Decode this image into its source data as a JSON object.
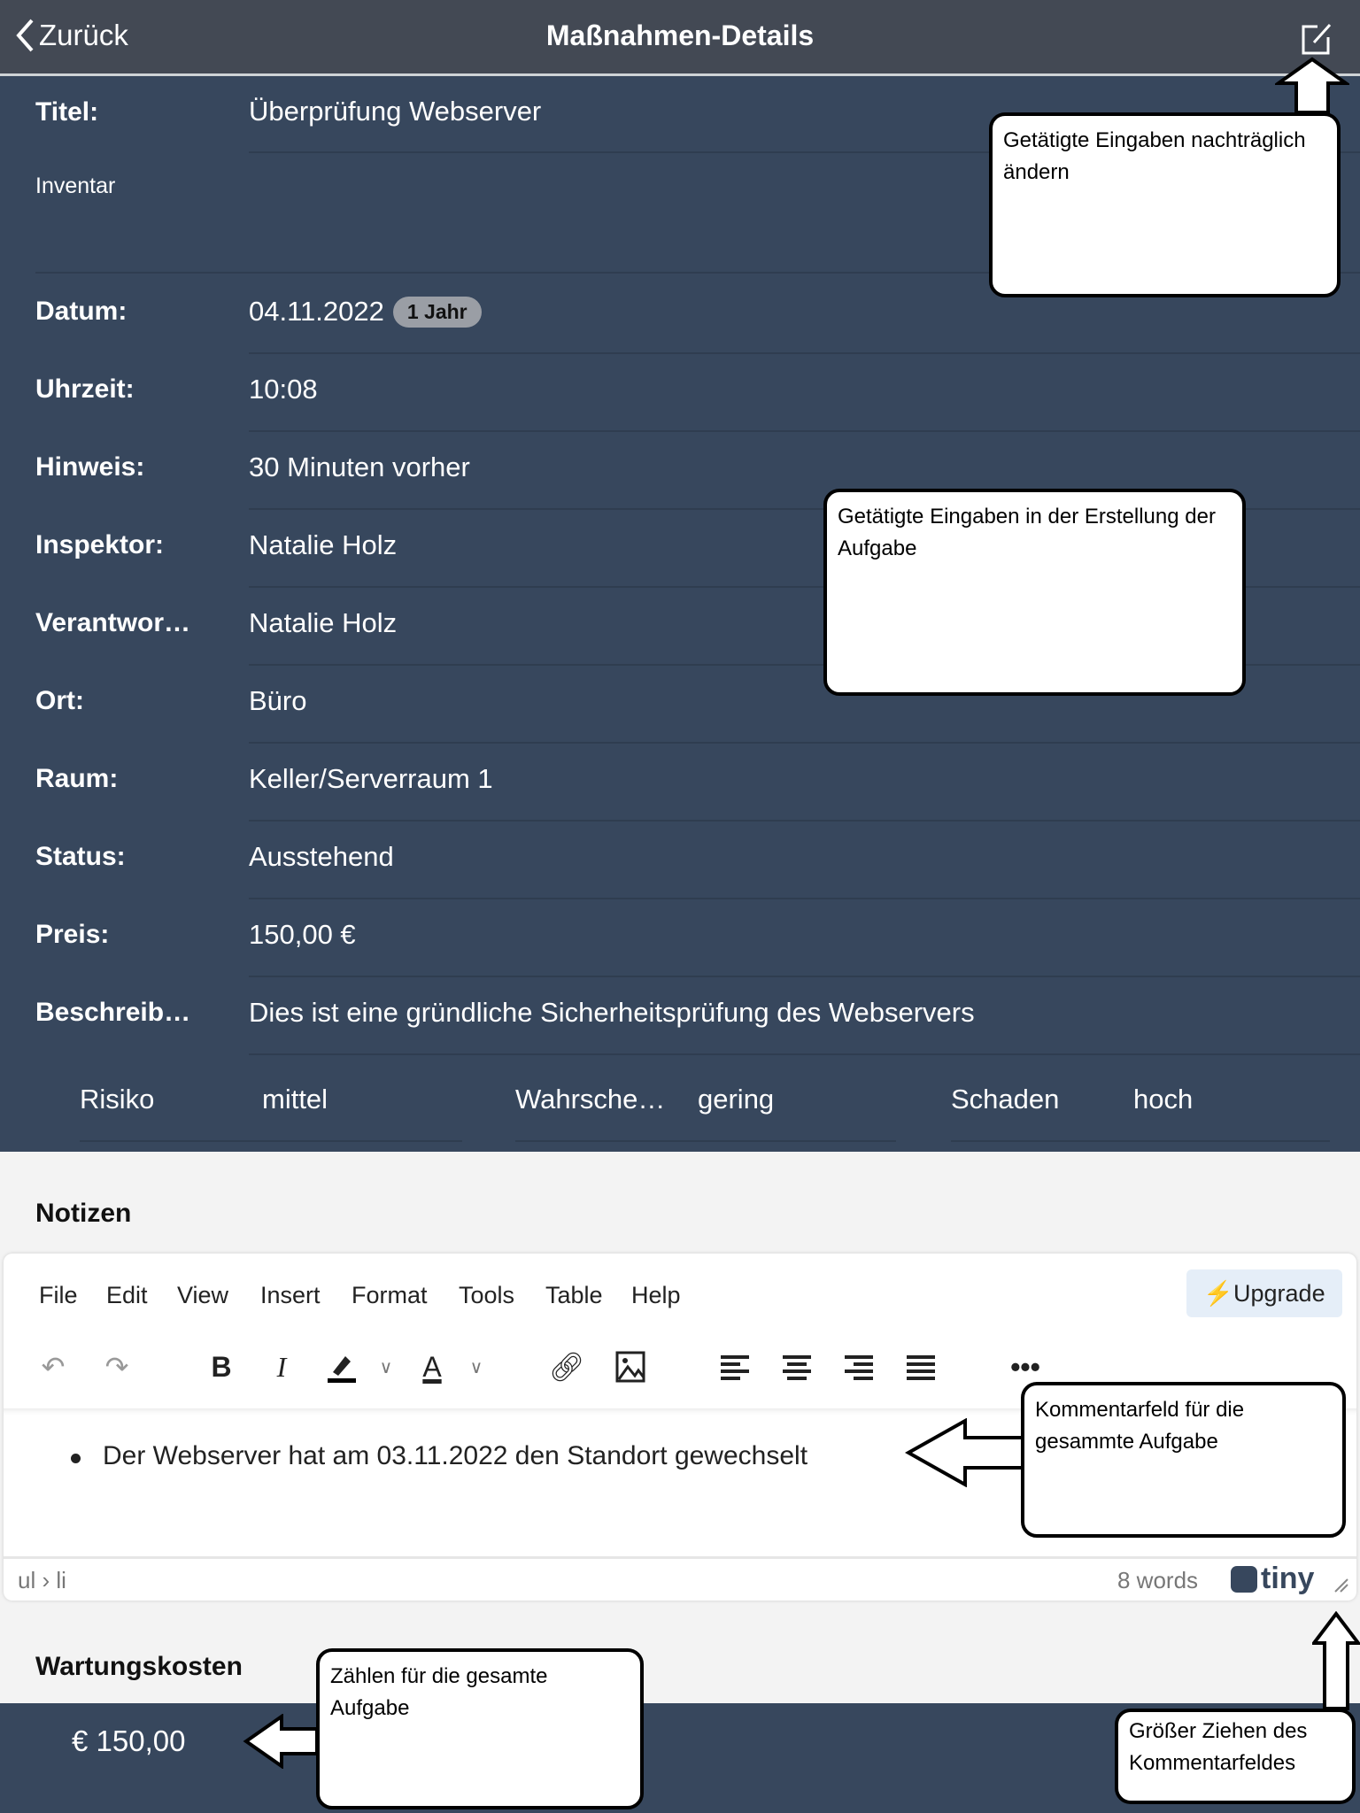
{
  "header": {
    "back_label": "Zurück",
    "title": "Maßnahmen-Details",
    "edit_icon": "edit-square-icon"
  },
  "details": {
    "title_label": "Titel:",
    "title_value": "Überprüfung Webserver",
    "category": "Inventar",
    "rows": [
      {
        "label": "Datum:",
        "value": "04.11.2022",
        "badge": "1 Jahr"
      },
      {
        "label": "Uhrzeit:",
        "value": "10:08"
      },
      {
        "label": "Hinweis:",
        "value": "30 Minuten vorher"
      },
      {
        "label": "Inspektor:",
        "value": "Natalie Holz"
      },
      {
        "label": "Verantwor…",
        "value": "Natalie Holz"
      },
      {
        "label": "Ort:",
        "value": "Büro"
      },
      {
        "label": "Raum:",
        "value": "Keller/Serverraum 1"
      },
      {
        "label": "Status:",
        "value": "Ausstehend"
      },
      {
        "label": "Preis:",
        "value": "150,00 €"
      },
      {
        "label": "Beschreib…",
        "value": "Dies ist eine gründliche Sicherheitsprüfung des Webservers"
      }
    ],
    "risk": [
      {
        "label": "Risiko",
        "value": "mittel"
      },
      {
        "label": "Wahrsche…",
        "value": "gering"
      },
      {
        "label": "Schaden",
        "value": "hoch"
      }
    ]
  },
  "notes": {
    "heading": "Notizen",
    "menu": [
      "File",
      "Edit",
      "View",
      "Insert",
      "Format",
      "Tools",
      "Table",
      "Help"
    ],
    "upgrade_label": "Upgrade",
    "content": "Der Webserver hat am 03.11.2022 den Standort gewechselt",
    "path": "ul › li",
    "word_count": "8 words",
    "brand": "tiny"
  },
  "costs": {
    "heading": "Wartungskosten",
    "value": "€ 150,00"
  },
  "callouts": {
    "edit": "Getätigte Eingaben nachträglich ändern",
    "inputs": "Getätigte Eingaben in der Erstellung der Aufgabe",
    "comment": "Kommentarfeld für die gesammte Aufgabe",
    "count": "Zählen für die gesamte Aufgabe",
    "resize": "Größer Ziehen des Kommentarfeldes"
  },
  "colors": {
    "header": "#434954",
    "panel": "#37475d",
    "background": "#f3f3f3",
    "upgrade_bg": "#e5eef8"
  }
}
